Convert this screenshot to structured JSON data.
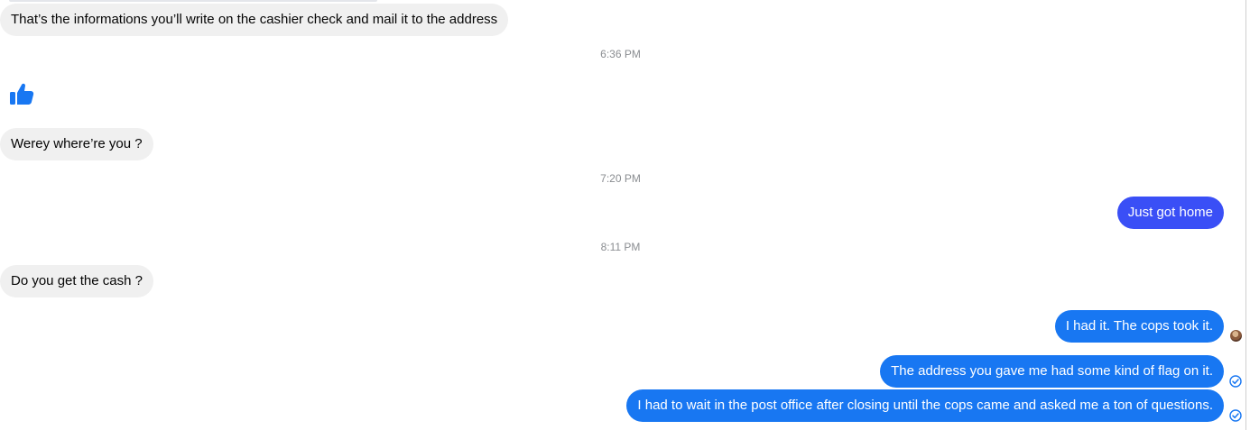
{
  "colors": {
    "incoming_bg": "#f0f0f0",
    "incoming_text": "#050505",
    "outgoing_bg_first": "#3a4ff6",
    "outgoing_bg": "#1877f2",
    "outgoing_text": "#ffffff",
    "timestamp_text": "#8a8d91",
    "like_icon": "#1877f2",
    "status_icon": "#1877f2"
  },
  "messages": [
    {
      "id": "m1",
      "direction": "in",
      "text": "That’s the informations you’ll write on the cashier check and mail it to the address"
    },
    {
      "id": "t1",
      "type": "timestamp",
      "text": "6:36 PM"
    },
    {
      "id": "m2",
      "direction": "in",
      "type": "like",
      "icon": "thumbs-up-icon"
    },
    {
      "id": "m3",
      "direction": "in",
      "text": "Werey where’re you ?"
    },
    {
      "id": "t2",
      "type": "timestamp",
      "text": "7:20 PM"
    },
    {
      "id": "m4",
      "direction": "out",
      "text": "Just got home"
    },
    {
      "id": "t3",
      "type": "timestamp",
      "text": "8:11 PM"
    },
    {
      "id": "m5",
      "direction": "in",
      "text": "Do you get the cash ?"
    },
    {
      "id": "m6",
      "direction": "out",
      "text": "I had it. The cops took it.",
      "status_icon": "seen-avatar"
    },
    {
      "id": "m7",
      "direction": "out",
      "text": "The address you gave me had some kind of flag on it.",
      "status_icon": "sent-check-icon"
    },
    {
      "id": "m8",
      "direction": "out",
      "text": "I had to wait in the post office after closing until the cops came and asked me a ton of questions.",
      "status_icon": "sent-check-icon"
    }
  ]
}
